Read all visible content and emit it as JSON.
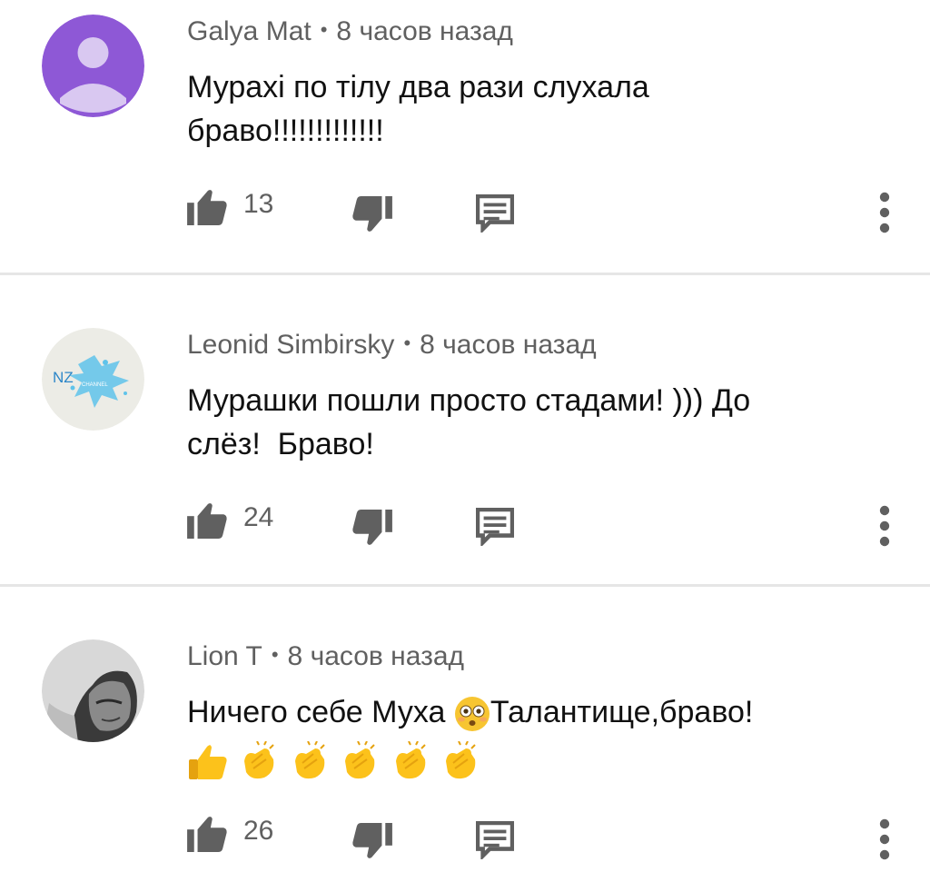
{
  "comments": [
    {
      "author": "Galya Mat",
      "time": "8 часов назад",
      "text_lines": [
        "Мурахі по тілу два рази слухала",
        "браво!!!!!!!!!!!!!"
      ],
      "likes": "13",
      "avatar": {
        "type": "default",
        "bg": "#8e58d6",
        "fg": "#d9c8f1"
      }
    },
    {
      "author": "Leonid Simbirsky",
      "time": "8 часов назад",
      "text_lines": [
        "Мурашки пошли просто стадами! ))) До",
        "слёз!  Браво!"
      ],
      "likes": "24",
      "avatar": {
        "type": "nz",
        "label": "NZ",
        "sub": "CHANNEL",
        "bg": "#ecece6",
        "fg": "#35a6d9"
      }
    },
    {
      "author": "Lion T",
      "time": "8 часов назад",
      "text_main": "Ничего себе Муха ",
      "text_after": "Талантище,браво!",
      "likes": "26",
      "avatar": {
        "type": "photo",
        "bg": "#dcdcdc"
      }
    }
  ],
  "icon_names": {
    "like": "thumbs-up-icon",
    "dislike": "thumbs-down-icon",
    "reply": "reply-comment-icon",
    "more": "more-vertical-icon"
  }
}
